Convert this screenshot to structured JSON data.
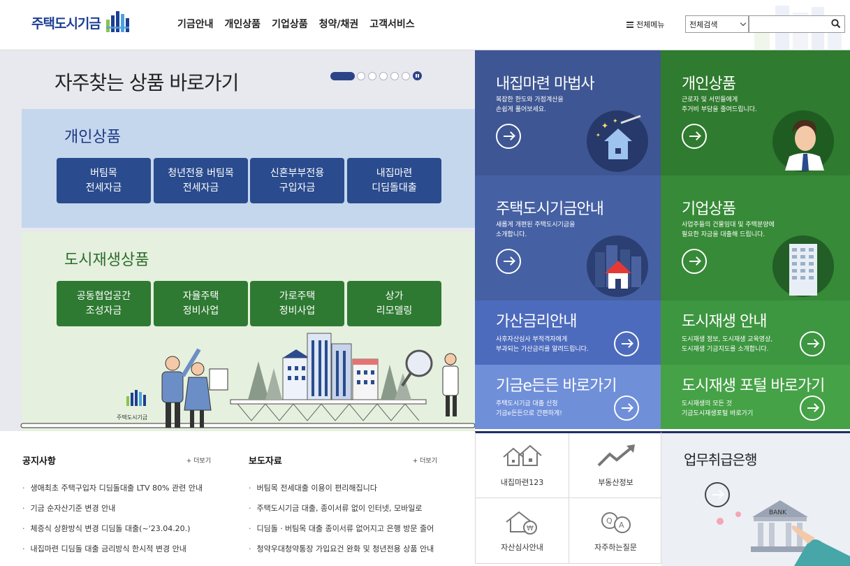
{
  "header": {
    "logo_text": "주택도시기금",
    "nav": [
      "기금안내",
      "개인상품",
      "기업상품",
      "청약/채권",
      "고객서비스"
    ],
    "all_menu": "전체메뉴",
    "search_select": "전체검색",
    "search_placeholder": ""
  },
  "quick": {
    "title": "자주찾는 상품 바로가기",
    "personal_title": "개인상품",
    "personal_buttons": [
      "버팀목\n전세자금",
      "청년전용 버팀목\n전세자금",
      "신혼부부전용\n구입자금",
      "내집마련\n디딤돌대출"
    ],
    "regen_title": "도시재생상품",
    "regen_buttons": [
      "공동협업공간\n조성자금",
      "자율주택\n정비사업",
      "가로주택\n정비사업",
      "상가\n리모델링"
    ],
    "small_logo": "주택도시기금"
  },
  "tiles": {
    "t1": {
      "title": "내집마련 마법사",
      "desc": "복잡한 한도와 가점계산을\n손쉽게 풀어보세요.",
      "color": "#3e5693"
    },
    "t2": {
      "title": "개인상품",
      "desc": "근로자 및 서민들에게\n주거비 부담을 줄여드립니다.",
      "color": "#2f7b2f"
    },
    "t3": {
      "title": "주택도시기금안내",
      "desc": "새롭게 개편된 주택도시기금을\n소개합니다.",
      "color": "#4560a3"
    },
    "t4": {
      "title": "기업상품",
      "desc": "사업주들의 건물임대 및 주택분양에\n필요한 자금을 대출해 드립니다.",
      "color": "#378a37"
    },
    "t5": {
      "title": "가산금리안내",
      "desc": "사후자산심사 부적격자에게\n부과되는 가산금리를 알려드립니다.",
      "color": "#4d6bbd"
    },
    "t6": {
      "title": "도시재생 안내",
      "desc": "도시재생 정보, 도시재생 교육영상,\n도시재생 기금지도를 소개합니다.",
      "color": "#3d9640"
    },
    "t7": {
      "title": "기금e든든 바로가기",
      "desc": "주택도시기금 대출 신청\n기금e든든으로 간편하게!",
      "color": "#6f8fd9"
    },
    "t8": {
      "title": "도시재생 포털 바로가기",
      "desc": "도시재생의 모든 것\n기금도시재생포털 바로가기",
      "color": "#46a247"
    }
  },
  "notice": {
    "title": "공지사항",
    "more": "+ 더보기",
    "items": [
      "생애최초 주택구입자 디딤돌대출 LTV 80% 관련 안내",
      "기금 순자산기준 변경 안내",
      "체증식 상환방식 변경 디딤돌 대출(~'23.04.20.)",
      "내집마련 디딤돌 대출 금리방식 한시적 변경 안내"
    ]
  },
  "press": {
    "title": "보도자료",
    "more": "+ 더보기",
    "items": [
      "버팀목 전세대출 이용이 편리해집니다",
      "주택도시기금 대출, 종이서류 없이 인터넷, 모바일로",
      "디딤돌ㆍ버팀목 대출 종이서류 없어지고 은행 방문 줄어",
      "청약우대청약통장 가입요건 완화 및 청년전용 상품 안내"
    ]
  },
  "services": [
    "내집마련123",
    "부동산정보",
    "자산심사안내",
    "자주하는질문"
  ],
  "bank": {
    "title": "업무취급은행",
    "sign": "BANK"
  }
}
